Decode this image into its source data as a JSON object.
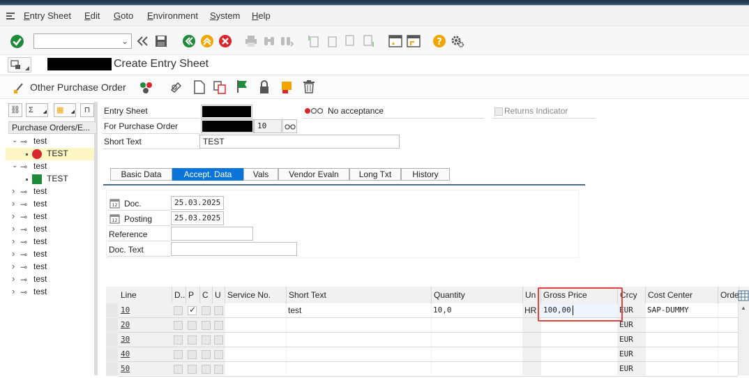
{
  "menu": [
    "Entry Sheet",
    "Edit",
    "Goto",
    "Environment",
    "System",
    "Help"
  ],
  "title": "Create Entry Sheet",
  "app_toolbar": {
    "other_po_label": "Other Purchase Order"
  },
  "left_panel": {
    "header": "Purchase Orders/E...",
    "tree": [
      {
        "label": "test",
        "level": 0,
        "expanded": true
      },
      {
        "label": "TEST",
        "level": 1,
        "status": "red",
        "selected": true
      },
      {
        "label": "test",
        "level": 0,
        "expanded": true
      },
      {
        "label": "TEST",
        "level": 1,
        "status": "green"
      },
      {
        "label": "test",
        "level": 0
      },
      {
        "label": "test",
        "level": 0
      },
      {
        "label": "test",
        "level": 0
      },
      {
        "label": "test",
        "level": 0
      },
      {
        "label": "test",
        "level": 0
      },
      {
        "label": "test",
        "level": 0
      },
      {
        "label": "test",
        "level": 0
      },
      {
        "label": "test",
        "level": 0
      },
      {
        "label": "test",
        "level": 0
      }
    ]
  },
  "header_form": {
    "entry_sheet_label": "Entry Sheet",
    "po_label": "For Purchase Order",
    "po_item": "10",
    "short_text_label": "Short Text",
    "short_text_value": "TEST",
    "acceptance_status": "No acceptance",
    "returns_indicator": "Returns Indicator"
  },
  "tabs": [
    "Basic Data",
    "Accept. Data",
    "Vals",
    "Vendor Evaln",
    "Long Txt",
    "History"
  ],
  "active_tab": 1,
  "accept_data": {
    "doc_label": "Doc.",
    "doc_date": "25.03.2025",
    "posting_label": "Posting",
    "posting_date": "25.03.2025",
    "reference_label": "Reference",
    "doc_text_label": "Doc. Text"
  },
  "table": {
    "columns": [
      "Line",
      "D..",
      "P",
      "C",
      "U",
      "Service No.",
      "Short Text",
      "Quantity",
      "Un",
      "Gross Price",
      "Crcy",
      "Cost Center",
      "Orde"
    ],
    "rows": [
      {
        "line": "10",
        "short_text": "test",
        "quantity": "10,0",
        "unit": "HR",
        "gross_price": "100,00",
        "crcy": "EUR",
        "cost_center": "SAP-DUMMY",
        "p_checked": true
      },
      {
        "line": "20",
        "crcy": "EUR"
      },
      {
        "line": "30",
        "crcy": "EUR"
      },
      {
        "line": "40",
        "crcy": "EUR"
      },
      {
        "line": "50",
        "crcy": "EUR"
      }
    ]
  }
}
